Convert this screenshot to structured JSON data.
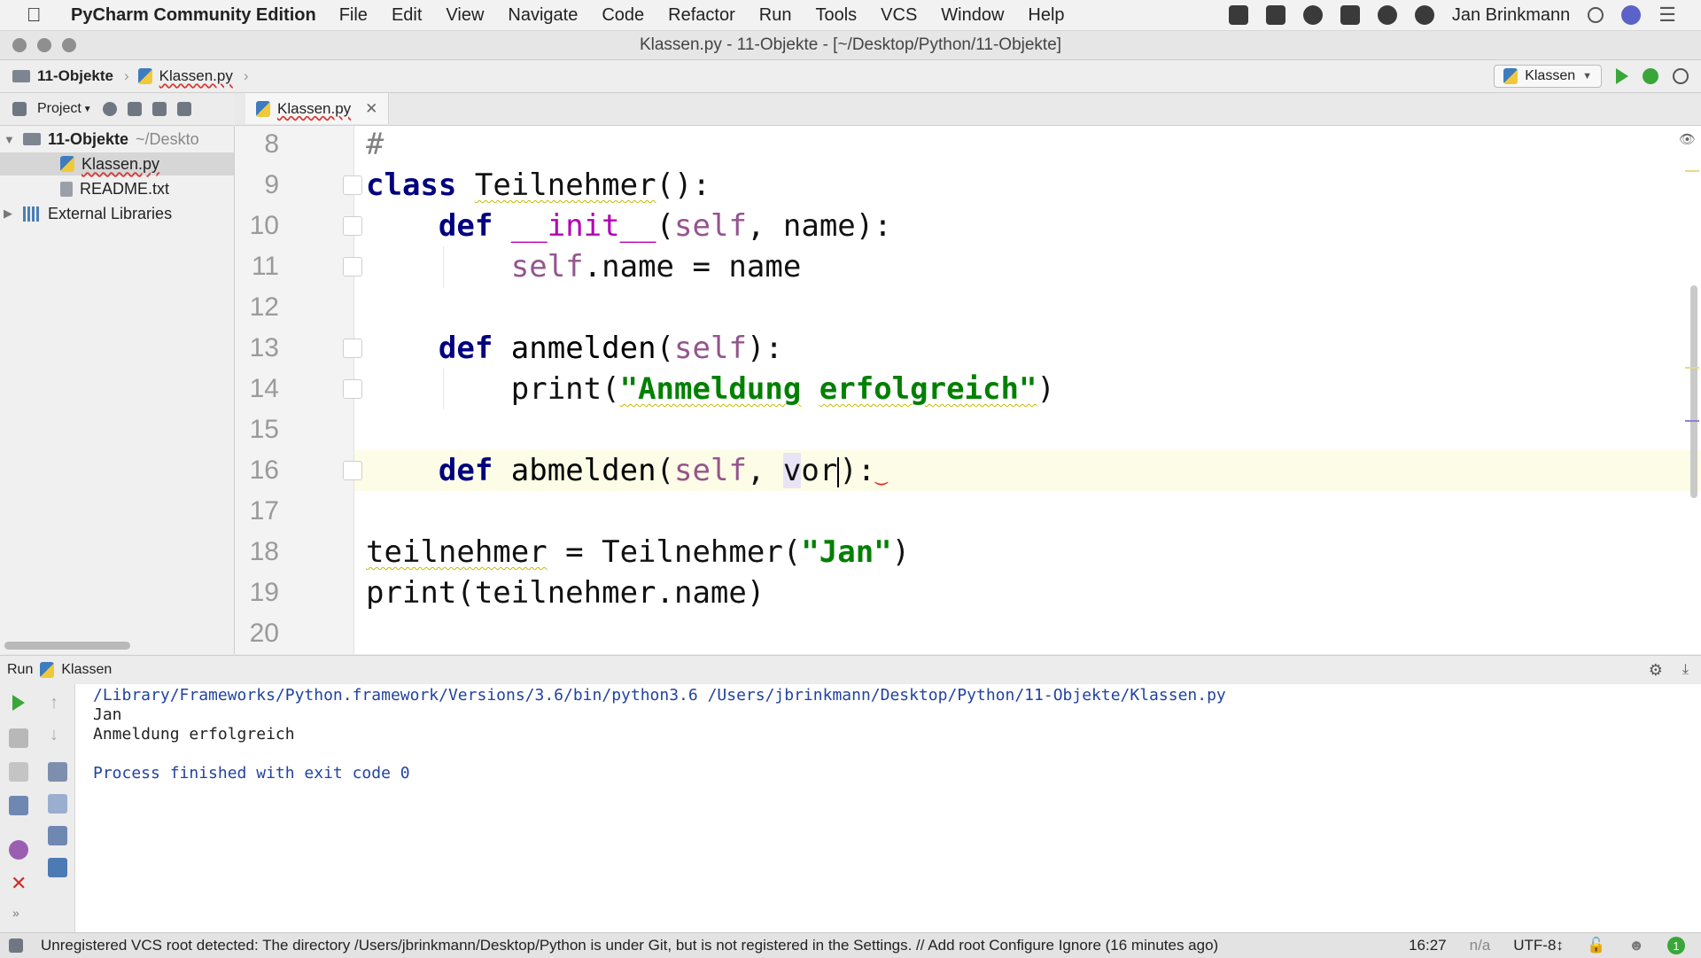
{
  "menubar": {
    "apple": "",
    "app_name": "PyCharm Community Edition",
    "items": [
      "File",
      "Edit",
      "View",
      "Navigate",
      "Code",
      "Refactor",
      "Run",
      "Tools",
      "VCS",
      "Window",
      "Help"
    ],
    "user": "Jan Brinkmann"
  },
  "window": {
    "title": "Klassen.py - 11-Objekte - [~/Desktop/Python/11-Objekte]"
  },
  "navbar": {
    "project": "11-Objekte",
    "file": "Klassen.py",
    "run_config": "Klassen"
  },
  "project_panel": {
    "label": "Project",
    "tree": {
      "root": "11-Objekte",
      "root_path": "~/Deskto",
      "files": [
        "Klassen.py",
        "README.txt"
      ],
      "libs": "External Libraries"
    }
  },
  "editor": {
    "tab": "Klassen.py",
    "line_numbers": [
      "8",
      "9",
      "10",
      "11",
      "12",
      "13",
      "14",
      "15",
      "16",
      "17",
      "18",
      "19",
      "20"
    ],
    "lines": {
      "l8": "#",
      "l9_kw": "class",
      "l9_name": "Teilnehmer",
      "l9_rest": "():",
      "l10_kw": "def",
      "l10_fn": "__init__",
      "l10_open": "(",
      "l10_self": "self",
      "l10_rest": ", name):",
      "l11_self": "self",
      "l11_rest": ".name = name",
      "l13_kw": "def",
      "l13_fn": "anmelden",
      "l13_open": "(",
      "l13_self": "self",
      "l13_rest": "):",
      "l14_pre": "print(",
      "l14_str1": "\"Anmeldung",
      "l14_sp": " ",
      "l14_str2": "erfolgreich\"",
      "l14_post": ")",
      "l16_kw": "def",
      "l16_fn": "abmelden",
      "l16_open": "(",
      "l16_self": "self",
      "l16_comma": ", ",
      "l16_v": "v",
      "l16_param": "or",
      "l16_rest": "):",
      "l18_var": "teilnehmer",
      "l18_mid": " = Teilnehmer(",
      "l18_str": "\"Jan\"",
      "l18_post": ")",
      "l19": "print(teilnehmer.name)"
    }
  },
  "run_panel": {
    "label": "Run",
    "config": "Klassen",
    "output": [
      "/Library/Frameworks/Python.framework/Versions/3.6/bin/python3.6 /Users/jbrinkmann/Desktop/Python/11-Objekte/Klassen.py",
      "Jan",
      "Anmeldung erfolgreich",
      "",
      "Process finished with exit code 0"
    ]
  },
  "statusbar": {
    "message": "Unregistered VCS root detected: The directory /Users/jbrinkmann/Desktop/Python is under Git, but is not registered in the Settings. // Add root  Configure  Ignore (16 minutes ago)",
    "position": "16:27",
    "line_sep": "n/a",
    "encoding": "UTF-8↕",
    "events": "1"
  }
}
